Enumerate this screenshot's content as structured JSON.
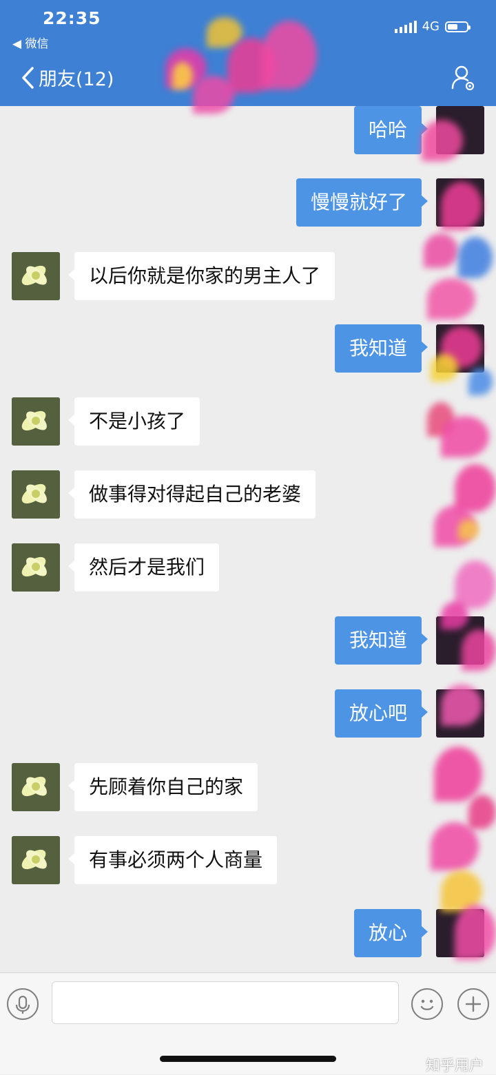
{
  "status_bar": {
    "time": "22:35",
    "back_app": "◀ 微信",
    "network": "4G"
  },
  "nav": {
    "title": "朋友(12)"
  },
  "messages": [
    {
      "side": "right",
      "text": "哈哈"
    },
    {
      "side": "right",
      "text": "慢慢就好了"
    },
    {
      "side": "left",
      "text": "以后你就是你家的男主人了"
    },
    {
      "side": "right",
      "text": "我知道"
    },
    {
      "side": "left",
      "text": "不是小孩了"
    },
    {
      "side": "left",
      "text": "做事得对得起自己的老婆"
    },
    {
      "side": "left",
      "text": "然后才是我们"
    },
    {
      "side": "right",
      "text": "我知道"
    },
    {
      "side": "right",
      "text": "放心吧"
    },
    {
      "side": "left",
      "text": "先顾着你自己的家"
    },
    {
      "side": "left",
      "text": "有事必须两个人商量"
    },
    {
      "side": "right",
      "text": "放心"
    }
  ],
  "input": {
    "value": ""
  },
  "watermark": "知乎用户",
  "colors": {
    "header": "#3d80d4",
    "outgoing_bubble": "#4e94e4",
    "incoming_bubble": "#ffffff",
    "background": "#ededed"
  },
  "icons": [
    "back-chevron-icon",
    "group-settings-icon",
    "microphone-icon",
    "emoji-icon",
    "plus-icon"
  ]
}
